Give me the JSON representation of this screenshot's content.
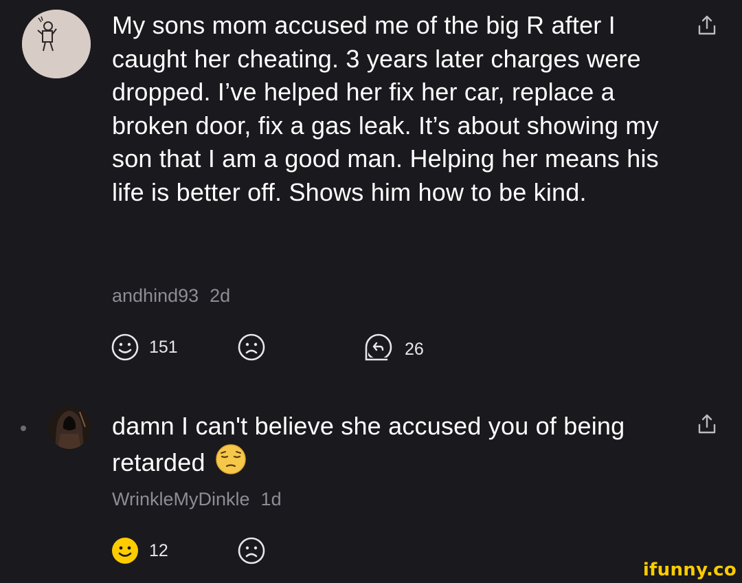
{
  "comments": [
    {
      "text": "My sons mom accused me of the big R after I caught her cheating. 3 years later charges were dropped. I’ve helped her fix her car, replace a broken door, fix a gas leak. It’s about showing my son that I am a good man. Helping her means his life is better off. Shows him how to be kind.",
      "username": "andhind93",
      "time": "2d",
      "upvotes": "151",
      "replies": "26"
    },
    {
      "text": "damn I can't believe she accused you of being retarded",
      "emoji": "pensive-face-emoji",
      "username": "WrinkleMyDinkle",
      "time": "1d",
      "upvotes": "12",
      "upvoted": true
    }
  ],
  "watermark": "ifunny.co",
  "colors": {
    "background": "#1a191e",
    "text": "#ffffff",
    "meta": "#8f8d94",
    "active_smile": "#ffcc00",
    "watermark": "#ffcc00"
  },
  "icons": [
    "share-icon",
    "smile-upvote-icon",
    "frown-downvote-icon",
    "reply-icon",
    "avatar-astronaut",
    "avatar-hooded-figure"
  ]
}
